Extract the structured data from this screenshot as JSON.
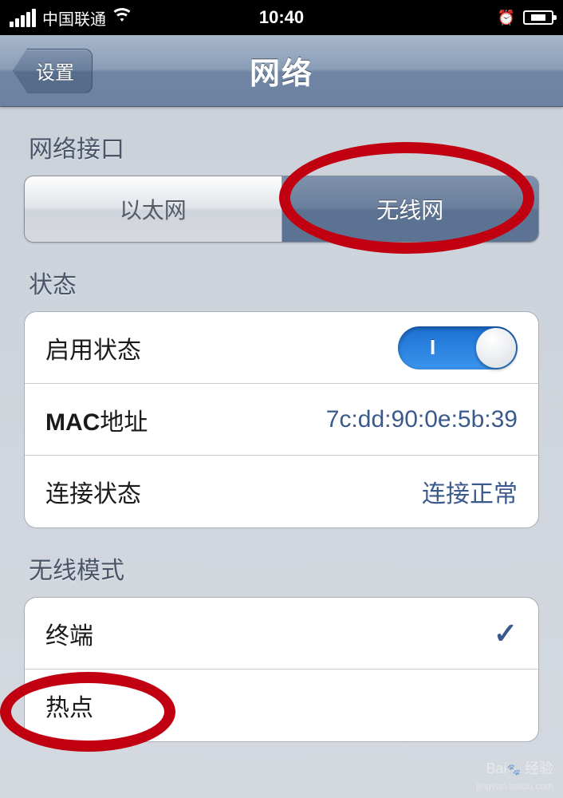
{
  "statusbar": {
    "carrier": "中国联通",
    "time": "10:40"
  },
  "nav": {
    "back_label": "设置",
    "title": "网络"
  },
  "sections": {
    "interface_header": "网络接口",
    "status_header": "状态",
    "wireless_mode_header": "无线模式"
  },
  "segmented": {
    "ethernet": "以太网",
    "wireless": "无线网"
  },
  "status_rows": {
    "enable_label": "启用状态",
    "toggle_on_text": "I",
    "mac_label_bold": "MAC",
    "mac_label_rest": "地址",
    "mac_value": "7c:dd:90:0e:5b:39",
    "conn_label": "连接状态",
    "conn_value": "连接正常"
  },
  "wireless_mode_rows": {
    "terminal": "终端",
    "hotspot": "热点"
  },
  "watermark": {
    "brand": "Bai",
    "brand2": "经验",
    "url": "jingyan.baidu.com"
  }
}
